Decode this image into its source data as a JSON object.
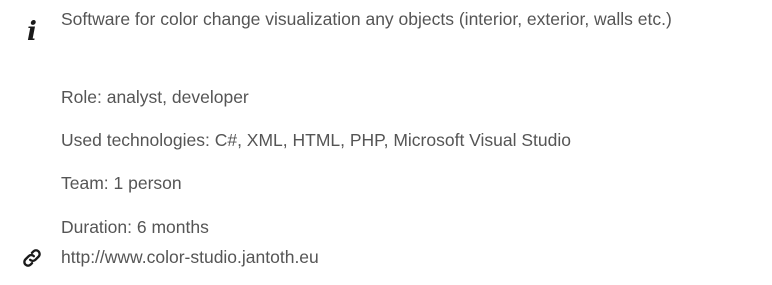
{
  "project": {
    "description": "Software for color change visualization any objects (interior, exterior, walls etc.)",
    "role": "Role: analyst, developer",
    "technologies": "Used technologies: C#, XML, HTML, PHP, Microsoft Visual Studio",
    "team": "Team: 1 person",
    "duration": "Duration: 6 months",
    "link": "http://www.color-studio.jantoth.eu"
  },
  "icons": {
    "info": "info-icon",
    "link": "link-icon"
  },
  "colors": {
    "text": "#555555",
    "icon": "#1a1a1a"
  }
}
